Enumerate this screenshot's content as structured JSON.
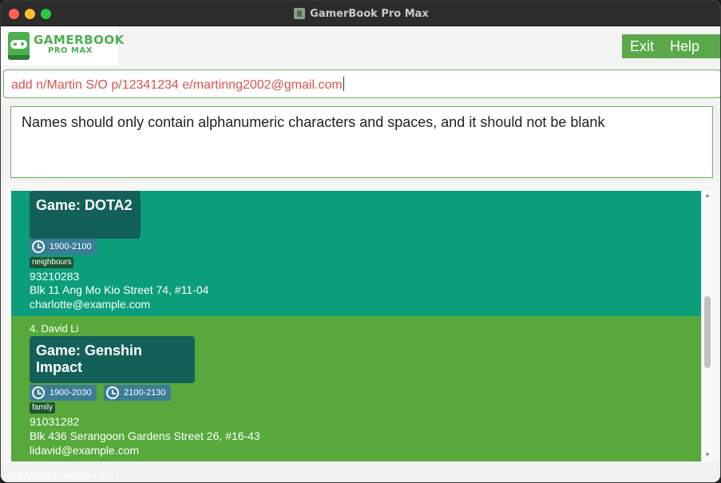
{
  "window": {
    "title": "GamerBook Pro Max"
  },
  "logo": {
    "title": "GAMERBOOK",
    "subtitle": "PRO MAX"
  },
  "menu": {
    "items": [
      "Exit",
      "Help"
    ]
  },
  "command": {
    "value": "add n/Martin S/O p/12341234 e/martinng2002@gmail.com"
  },
  "result": {
    "message": "Names should only contain alphanumeric characters and spaces, and it should not be blank"
  },
  "persons": [
    {
      "name": "",
      "game": "Game: DOTA2",
      "timeslots": [
        "1900-2100"
      ],
      "tags": [
        "neighbours"
      ],
      "phone": "93210283",
      "address": "Blk 11 Ang Mo Kio Street 74, #11-04",
      "email": "charlotte@example.com"
    },
    {
      "name": "4.  David Li",
      "game": "Game: Genshin Impact",
      "timeslots": [
        "1900-2030",
        "2100-2130"
      ],
      "tags": [
        "family"
      ],
      "phone": "91031282",
      "address": "Blk 436 Serangoon Gardens Street 26, #16-43",
      "email": "lidavid@example.com"
    }
  ],
  "status": {
    "path": "data/addressbook.json"
  },
  "colors": {
    "accent": "#5aa84a",
    "card_teal": "#0c9e7b",
    "card_green": "#57a93b",
    "game_box": "#136059",
    "time_badge": "#3b7c97",
    "tag": "#1d5530",
    "error_text": "#d9534f"
  },
  "icons": {
    "window": [
      "close-icon",
      "minimize-icon",
      "maximize-icon",
      "app-icon"
    ],
    "timeslot": "clock-icon",
    "logo": "gamepad-book-icon"
  }
}
